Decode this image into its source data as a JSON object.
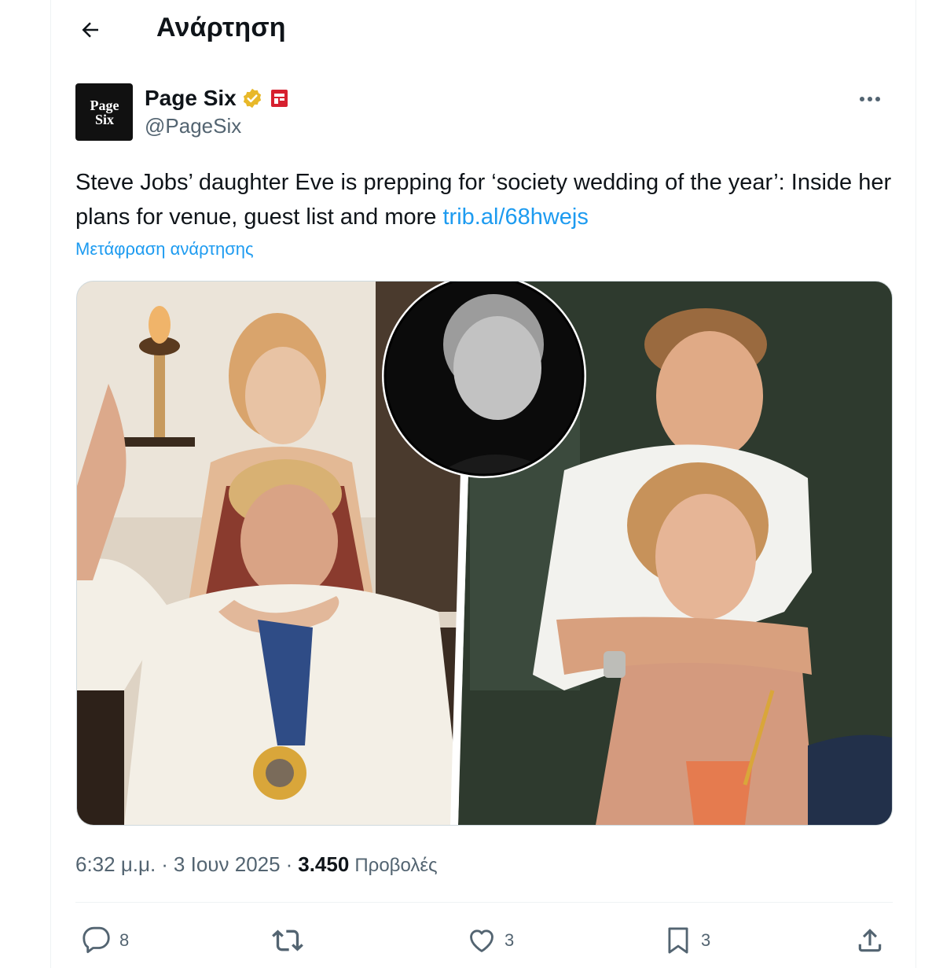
{
  "header": {
    "title": "Ανάρτηση",
    "back_icon": "arrow-left-icon"
  },
  "tweet": {
    "author": {
      "display_name": "Page Six",
      "handle": "@PageSix",
      "avatar_text_line1": "Page",
      "avatar_text_line2": "Six",
      "verified_color": "#e8b829",
      "affiliate_color": "#d6202f"
    },
    "text": "Steve Jobs’ daughter Eve is prepping for ‘society wedding of the year’: Inside her plans for venue, guest list and more ",
    "link": "trib.al/68hwejs",
    "translate_label": "Μετάφραση ανάρτησης",
    "time": "6:32 μ.μ.",
    "date": "3 Ιουν 2025",
    "separator": "·",
    "views_count": "3.450",
    "views_label": "Προβολές"
  },
  "actions": {
    "replies": "8",
    "retweets": "",
    "likes": "3",
    "bookmarks": "3"
  },
  "colors": {
    "accent": "#1d9bf0",
    "secondary_text": "#536471",
    "border": "#eff3f4"
  }
}
